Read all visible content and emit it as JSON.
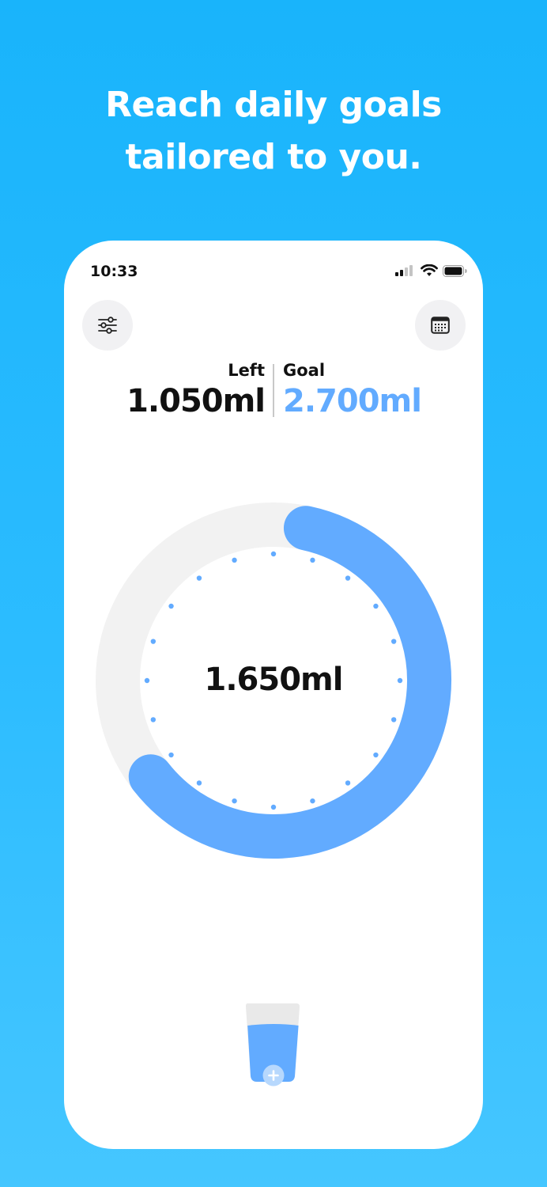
{
  "headline": {
    "line1": "Reach daily goals",
    "line2": "tailored to you."
  },
  "status_bar": {
    "time": "10:33",
    "icons": [
      "cellular-signal-icon",
      "wifi-icon",
      "battery-icon"
    ]
  },
  "toolbar": {
    "settings_icon": "sliders-icon",
    "calendar_icon": "calendar-icon"
  },
  "stats": {
    "left_label": "Left",
    "left_value": "1.050ml",
    "goal_label": "Goal",
    "goal_value": "2.700ml"
  },
  "progress": {
    "current": 1650,
    "goal": 2700,
    "current_label": "1.650ml"
  },
  "add_drink": {
    "icon": "water-glass-icon",
    "action_icon": "plus-icon"
  },
  "colors": {
    "background_top": "#19b4fb",
    "background_bottom": "#45c6ff",
    "accent_blue": "#62abff",
    "track_gray": "#f2f2f2",
    "text_dark": "#111111"
  }
}
